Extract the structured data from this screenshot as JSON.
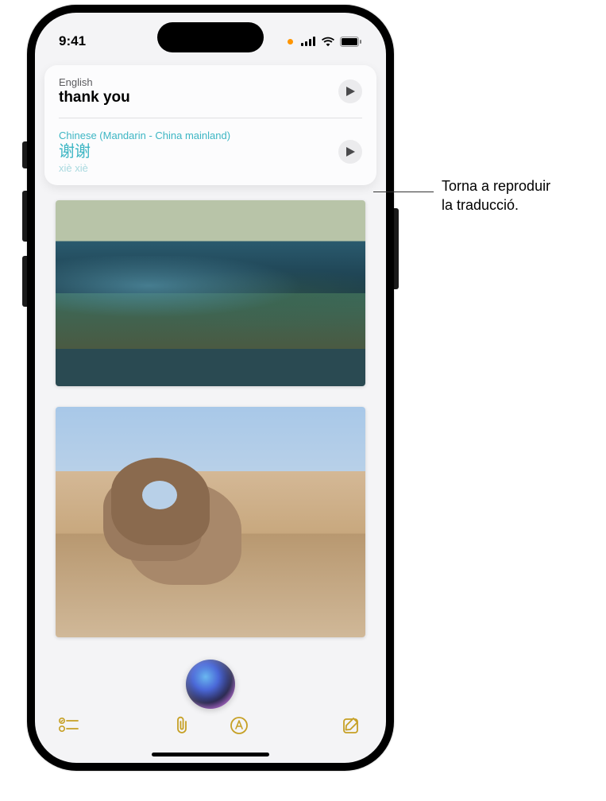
{
  "status": {
    "time": "9:41"
  },
  "translation": {
    "source": {
      "language": "English",
      "text": "thank you"
    },
    "target": {
      "language": "Chinese (Mandarin - China mainland)",
      "text": "谢谢",
      "romanization": "xiè xiè"
    }
  },
  "callout": {
    "line1": "Torna a reproduir",
    "line2": "la traducció."
  }
}
